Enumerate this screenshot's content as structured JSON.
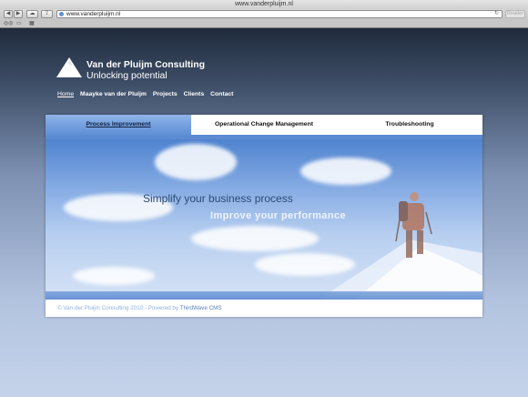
{
  "browser": {
    "window_title": "www.vanderpluijm.nl",
    "url": "www.vanderpluijm.nl",
    "reader_label": "Reader"
  },
  "site": {
    "title": "Van der Pluijm Consulting",
    "tagline": "Unlocking potential",
    "nav": [
      {
        "label": "Home",
        "active": true
      },
      {
        "label": "Maayke van der Pluijm"
      },
      {
        "label": "Projects"
      },
      {
        "label": "Clients"
      },
      {
        "label": "Contact"
      }
    ],
    "tabs": [
      {
        "label": "Process Improvement",
        "active": true
      },
      {
        "label": "Operational Change Management"
      },
      {
        "label": "Troubleshooting"
      }
    ],
    "hero": {
      "line1": "Simplify your business process",
      "line2": "Improve your performance"
    },
    "footer": {
      "text": "© Van der Pluijm Consulting 2010 - Powered by",
      "cms": "ThirdWave CMS"
    }
  }
}
